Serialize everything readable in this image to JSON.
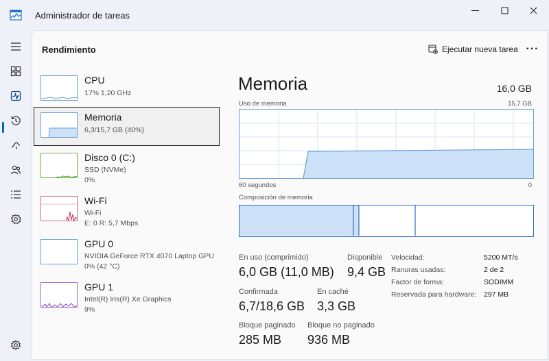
{
  "window": {
    "title": "Administrador de tareas",
    "icon": "task-manager-icon"
  },
  "header": {
    "page_title": "Rendimiento",
    "run_task_label": "Ejecutar nueva tarea",
    "more_label": "···"
  },
  "nav": {
    "items": [
      "menu-icon",
      "processes-icon",
      "performance-icon",
      "history-icon",
      "startup-icon",
      "users-icon",
      "details-icon",
      "services-icon",
      "settings-icon"
    ],
    "active": "performance-icon"
  },
  "devices": [
    {
      "name": "CPU",
      "line1": "17%  1,20 GHz",
      "line2": ""
    },
    {
      "name": "Memoria",
      "line1": "6,3/15,7 GB (40%)",
      "line2": ""
    },
    {
      "name": "Disco 0 (C:)",
      "line1": "SSD (NVMe)",
      "line2": "0%"
    },
    {
      "name": "Wi-Fi",
      "line1": "Wi-Fi",
      "line2": "E: 0  R: 5,7 Mbps"
    },
    {
      "name": "GPU 0",
      "line1": "NVIDIA GeForce RTX 4070 Laptop GPU",
      "line2": "0% (42 °C)"
    },
    {
      "name": "GPU 1",
      "line1": "Intel(R) Iris(R) Xe Graphics",
      "line2": "9%"
    }
  ],
  "detail": {
    "title": "Memoria",
    "total": "16,0 GB",
    "usage_label": "Uso de memoria",
    "usage_max": "15,7 GB",
    "time_left": "60 segundos",
    "time_right": "0",
    "composition_label": "Composición de memoria",
    "stats": {
      "in_use_label": "En uso (comprimido)",
      "in_use_value": "6,0 GB (11,0 MB)",
      "available_label": "Disponible",
      "available_value": "9,4 GB",
      "committed_label": "Confirmada",
      "committed_value": "6,7/18,6 GB",
      "cached_label": "En caché",
      "cached_value": "3,3 GB",
      "paged_label": "Bloque paginado",
      "paged_value": "285 MB",
      "nonpaged_label": "Bloque no paginado",
      "nonpaged_value": "936 MB"
    },
    "specs": [
      {
        "label": "Velocidad:",
        "value": "5200 MT/s"
      },
      {
        "label": "Ranuras usadas:",
        "value": "2 de 2"
      },
      {
        "label": "Factor de forma:",
        "value": "SODIMM"
      },
      {
        "label": "Reservada para hardware:",
        "value": "297 MB"
      }
    ]
  },
  "colors": {
    "accent": "#0067c0",
    "memory_fill": "#cce0f8",
    "memory_line": "#6aa0d8",
    "disk_line": "#4c9a2a",
    "wifi_line": "#c0305a",
    "gpu1_line": "#8a3cc0"
  }
}
